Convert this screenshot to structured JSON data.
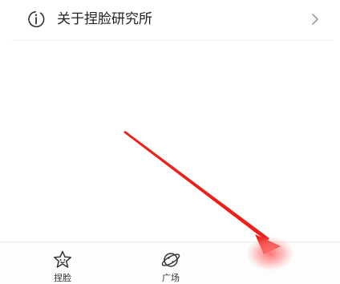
{
  "settings_list": {
    "about_item": {
      "icon": "info-circle-icon",
      "label": "关于捏脸研究所",
      "chevron": "chevron-right-icon"
    }
  },
  "annotation": {
    "type": "red-arrow",
    "color": "#e8231d"
  },
  "tabbar": {
    "tabs": [
      {
        "label": "捏脸",
        "icon": "star-face-icon"
      },
      {
        "label": "广场",
        "icon": "planet-icon"
      }
    ]
  },
  "colors": {
    "icon_stroke": "#333333",
    "text": "#222222",
    "chevron": "#9a9a9a",
    "divider": "#f1f1f1"
  }
}
